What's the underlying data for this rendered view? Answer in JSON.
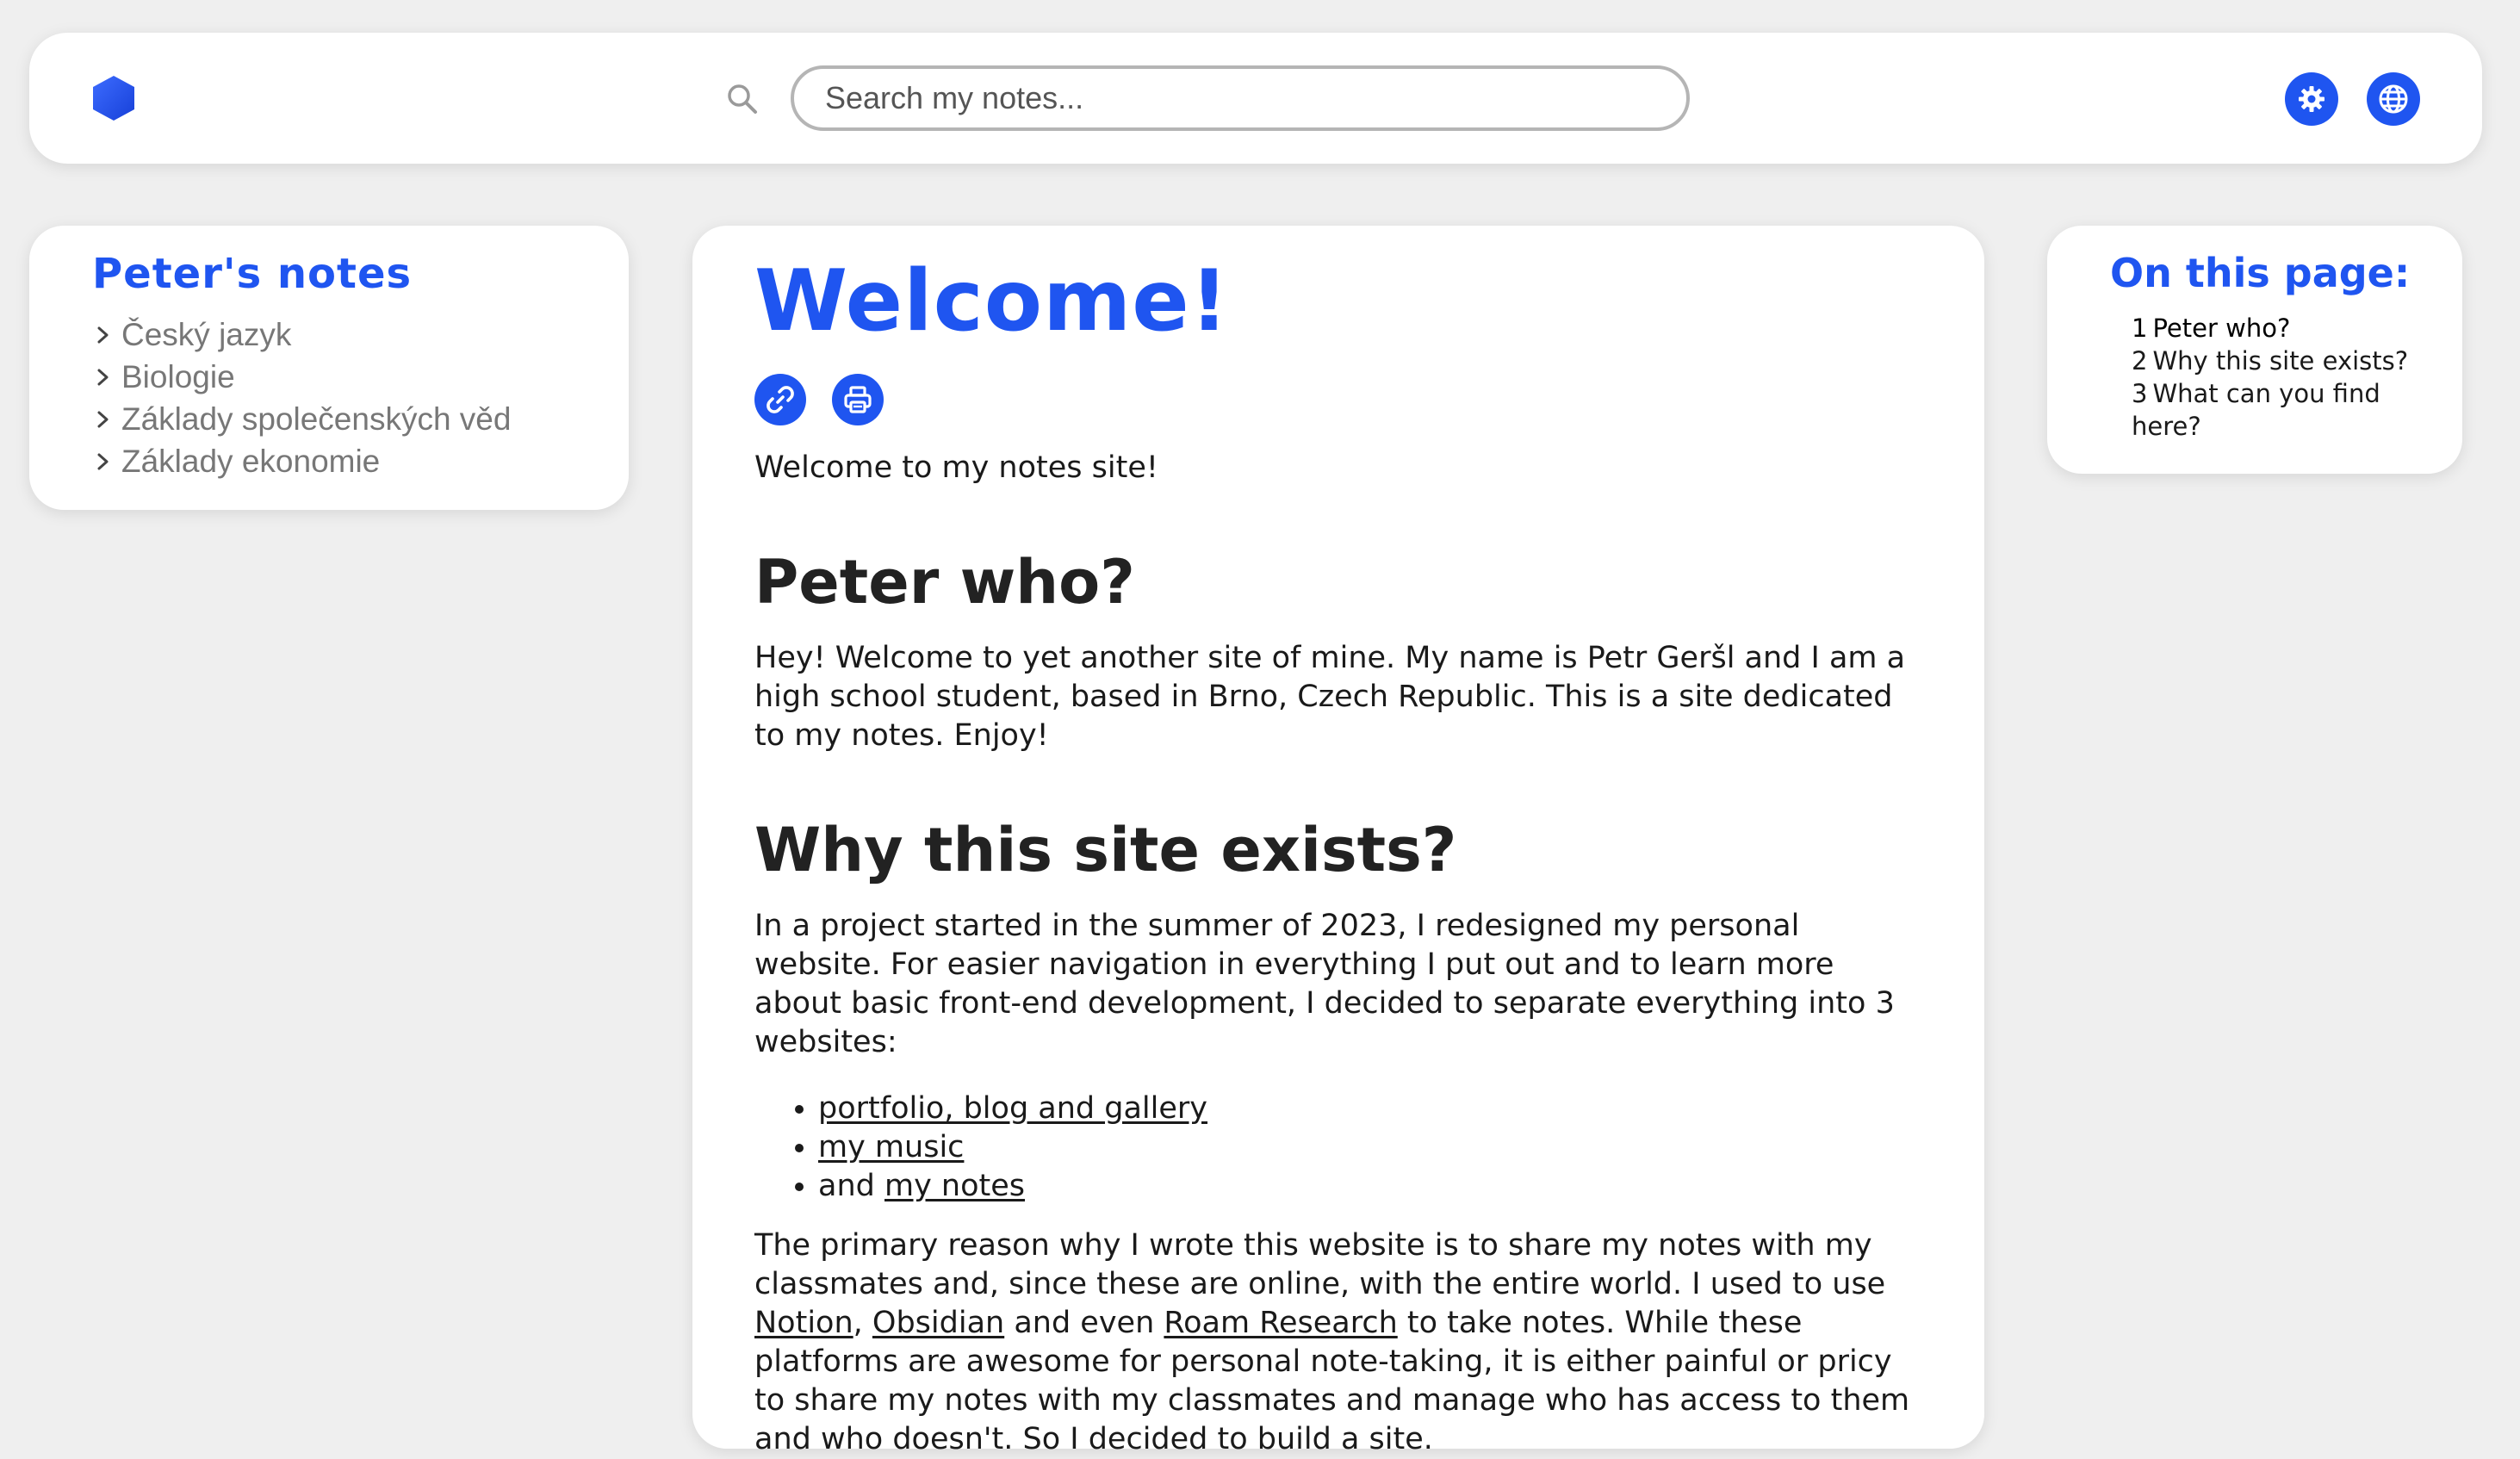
{
  "colors": {
    "accent": "#1f55f0",
    "background": "#efefef",
    "card": "#ffffff",
    "nav_text": "#777777"
  },
  "header": {
    "logo_icon": "hexagon-logo-icon",
    "search_icon": "search-icon",
    "search_placeholder": "Search my notes...",
    "settings_icon": "gear-icon",
    "language_icon": "globe-icon"
  },
  "sidebar": {
    "title": "Peter's notes",
    "items": [
      {
        "label": "Český jazyk",
        "icon": "chevron-right-icon"
      },
      {
        "label": "Biologie",
        "icon": "chevron-right-icon"
      },
      {
        "label": "Základy společenských věd",
        "icon": "chevron-right-icon"
      },
      {
        "label": "Základy ekonomie",
        "icon": "chevron-right-icon"
      }
    ]
  },
  "toc": {
    "title": "On this page:",
    "items": [
      {
        "num": "1",
        "label": "Peter who?"
      },
      {
        "num": "2",
        "label": "Why this site exists?"
      },
      {
        "num": "3",
        "label": "What can you find here?"
      }
    ]
  },
  "main": {
    "title": "Welcome!",
    "actions": {
      "copy_link_icon": "link-icon",
      "print_icon": "printer-icon"
    },
    "intro": "Welcome to my notes site!",
    "section1": {
      "heading": "Peter who?",
      "body": "Hey! Welcome to yet another site of mine. My name is Petr Geršl and I am a high school student, based in Brno, Czech Republic. This is a site dedicated to my notes. Enjoy!"
    },
    "section2": {
      "heading": "Why this site exists?",
      "body": "In a project started in the summer of 2023, I redesigned my personal website. For easier navigation in everything I put out and to learn more about basic front-end development, I decided to separate everything into 3 websites:",
      "bullets": {
        "item1_link": "portfolio, blog and gallery",
        "item2_link": "my music",
        "item3_prefix": "and ",
        "item3_link": "my notes"
      },
      "para2": {
        "part1": "The primary reason why I wrote this website is to share my notes with my classmates and, since these are online, with the entire world. I used to use ",
        "link_notion": "Notion",
        "sep": ", ",
        "link_obsidian": "Obsidian",
        "part2": " and even ",
        "link_roam": "Roam Research",
        "part3": " to take notes. While these platforms are awesome for personal note-taking, it is either painful or pricy to share my notes with my classmates and manage who has access to them and who doesn't. So I decided to build a site."
      }
    }
  }
}
